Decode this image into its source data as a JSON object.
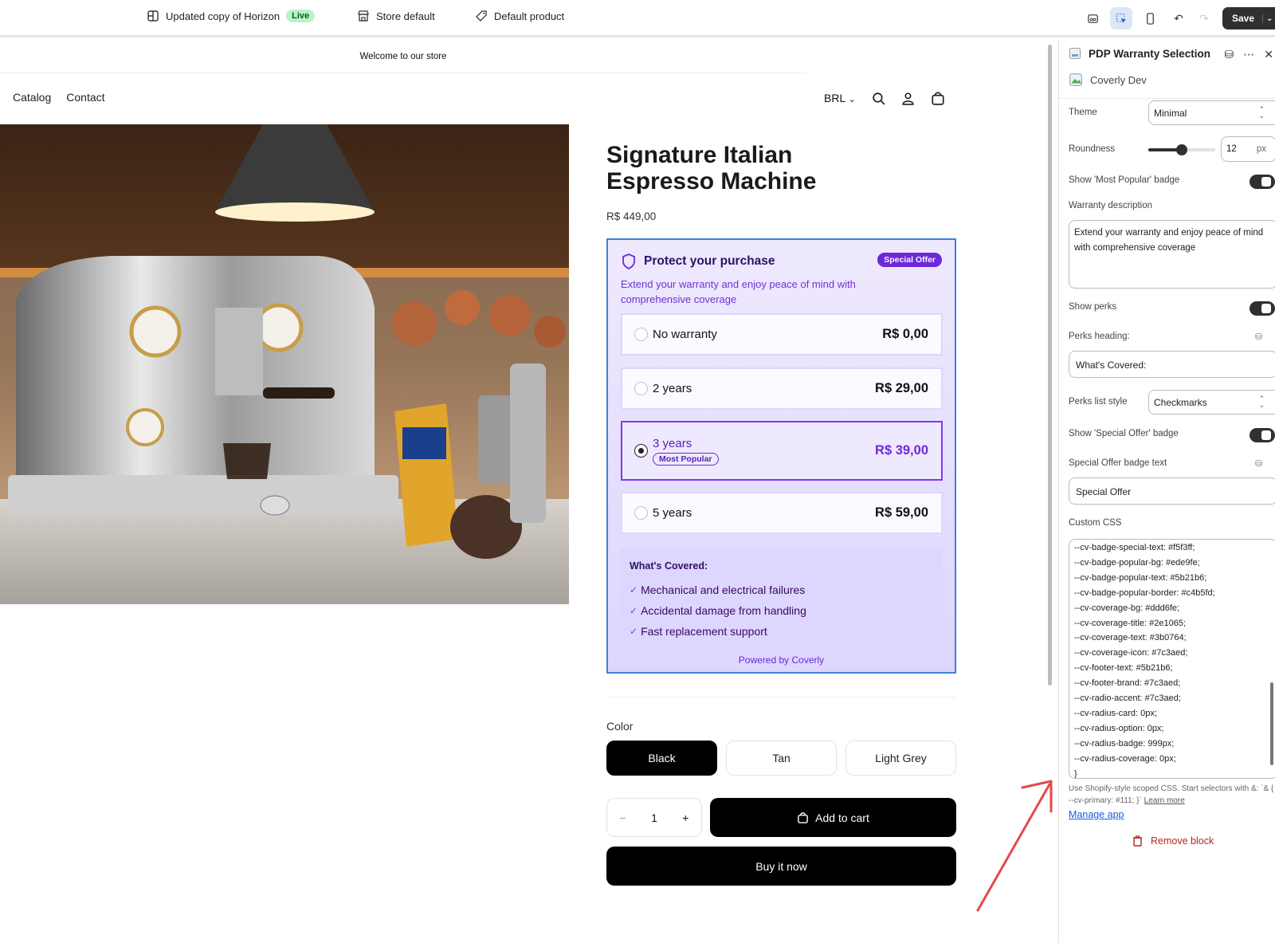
{
  "topbar": {
    "theme_name": "Updated copy of Horizon",
    "theme_status": "Live",
    "store_label": "Store default",
    "product_label": "Default product",
    "save_label": "Save"
  },
  "store": {
    "announcement": "Welcome to our store",
    "nav": [
      "Catalog",
      "Contact"
    ],
    "currency": "BRL",
    "product_title": "Signature Italian Espresso Machine",
    "price": "R$ 449,00",
    "warranty": {
      "heading": "Protect your purchase",
      "badge": "Special Offer",
      "description": "Extend your warranty and enjoy peace of mind with comprehensive coverage",
      "options": [
        {
          "label": "No warranty",
          "price": "R$ 0,00",
          "selected": false
        },
        {
          "label": "2 years",
          "price": "R$ 29,00",
          "selected": false
        },
        {
          "label": "3 years",
          "price": "R$ 39,00",
          "selected": true,
          "badge": "Most Popular"
        },
        {
          "label": "5 years",
          "price": "R$ 59,00",
          "selected": false
        }
      ],
      "coverage_title": "What's Covered:",
      "coverage_items": [
        "Mechanical and electrical failures",
        "Accidental damage from handling",
        "Fast replacement support"
      ],
      "powered": "Powered by Coverly"
    },
    "color_label": "Color",
    "colors": [
      "Black",
      "Tan",
      "Light Grey"
    ],
    "selected_color": "Black",
    "quantity": "1",
    "qty_minus": "−",
    "qty_plus": "+",
    "add_to_cart": "Add to cart",
    "buy_now": "Buy it now"
  },
  "panel": {
    "block_title": "PDP Warranty Selection",
    "app_name": "Coverly Dev",
    "theme_label": "Theme",
    "theme_value": "Minimal",
    "roundness_label": "Roundness",
    "roundness_value": "12",
    "roundness_fraction": 0.5,
    "roundness_unit": "px",
    "popular_badge_label": "Show 'Most Popular' badge",
    "popular_badge_on": true,
    "warranty_desc_label": "Warranty description",
    "warranty_desc_value": "Extend your warranty and enjoy peace of mind with comprehensive coverage",
    "show_perks_label": "Show perks",
    "show_perks_on": true,
    "perks_heading_label": "Perks heading:",
    "perks_heading_value": "What's Covered:",
    "perks_style_label": "Perks list style",
    "perks_style_value": "Checkmarks",
    "special_badge_label": "Show 'Special Offer' badge",
    "special_badge_on": true,
    "special_text_label": "Special Offer badge text",
    "special_text_value": "Special Offer",
    "custom_css_label": "Custom CSS",
    "css_lines": [
      "--cv-badge-special-text: #f5f3ff;",
      "--cv-badge-popular-bg: #ede9fe;",
      "--cv-badge-popular-text: #5b21b6;",
      "--cv-badge-popular-border: #c4b5fd;",
      "--cv-coverage-bg: #ddd6fe;",
      "--cv-coverage-title: #2e1065;",
      "--cv-coverage-text: #3b0764;",
      "--cv-coverage-icon: #7c3aed;",
      "--cv-footer-text: #5b21b6;",
      "--cv-footer-brand: #7c3aed;",
      "--cv-radio-accent: #7c3aed;",
      "--cv-radius-card: 0px;",
      "--cv-radius-option: 0px;",
      "--cv-radius-badge: 999px;",
      "--cv-radius-coverage: 0px;",
      "}"
    ],
    "help_text": "Use Shopify-style scoped CSS. Start selectors with &: `& { --cv-primary: #111; }`",
    "learn_more": "Learn more",
    "manage_app": "Manage app",
    "remove_block": "Remove block"
  },
  "colors": {
    "accent": "#7c3aed",
    "warranty_border": "#3d7fd9",
    "save_bg": "#303030",
    "remove_red": "#b3261e",
    "annotation_arrow": "#e5484d"
  },
  "icons": [
    "layout-icon",
    "store-icon",
    "tag-icon",
    "inspector-icon",
    "select-icon",
    "mobile-icon",
    "undo-icon",
    "redo-icon",
    "search-icon",
    "account-icon",
    "cart-icon",
    "shield-icon",
    "check-icon",
    "bag-icon",
    "database-icon",
    "more-icon",
    "close-icon",
    "trash-icon",
    "arrow-annotation"
  ]
}
